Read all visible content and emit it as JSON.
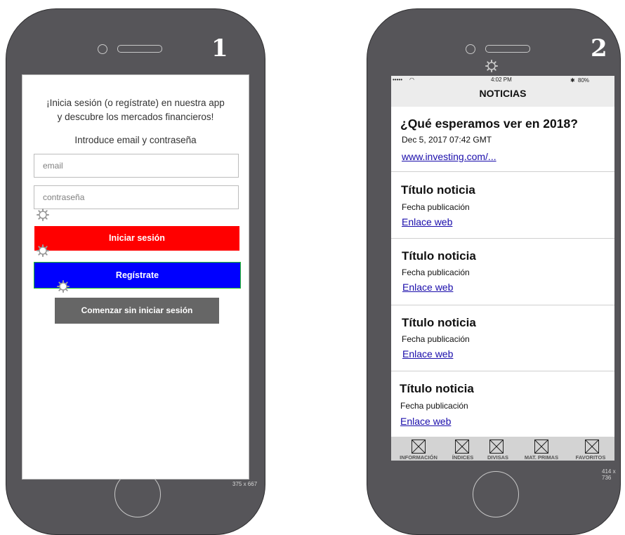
{
  "phone1": {
    "number": "1",
    "dimension_label": "375 x 667",
    "intro_line1": "¡Inicia sesión (o regístrate) en nuestra app",
    "intro_line2": "y descubre los mercados financieros!",
    "instruction": "Introduce email y contraseña",
    "email_placeholder": "email",
    "password_placeholder": "contraseña",
    "login_label": "Iniciar sesión",
    "register_label": "Regístrate",
    "guest_label": "Comenzar sin iniciar sesión",
    "colors": {
      "login": "#ff0000",
      "register": "#0000ff",
      "guest": "#666666"
    }
  },
  "phone2": {
    "number": "2",
    "dimension_label": "414 x 736",
    "status": {
      "signal": "••••• ",
      "time": "4:02 PM",
      "battery": "80%"
    },
    "header_title": "NOTICIAS",
    "news": [
      {
        "title": "¿Qué esperamos ver en 2018?",
        "date": "Dec 5, 2017 07:42 GMT",
        "link": "www.investing.com/..."
      },
      {
        "title": "Título noticia",
        "date": "Fecha publicación",
        "link": "Enlace web"
      },
      {
        "title": "Título noticia",
        "date": "Fecha publicación",
        "link": "Enlace web"
      },
      {
        "title": "Título noticia",
        "date": "Fecha publicación",
        "link": "Enlace web"
      },
      {
        "title": "Título noticia",
        "date": "Fecha publicación",
        "link": "Enlace web"
      }
    ],
    "tabs": [
      {
        "label": "INFORMACIÓN",
        "icon": "image-placeholder-icon"
      },
      {
        "label": "ÍNDICES",
        "icon": "image-placeholder-icon"
      },
      {
        "label": "DIVISAS",
        "icon": "image-placeholder-icon"
      },
      {
        "label": "MAT. PRIMAS",
        "icon": "image-placeholder-icon"
      },
      {
        "label": "FAVORITOS",
        "icon": "image-placeholder-icon"
      }
    ]
  }
}
